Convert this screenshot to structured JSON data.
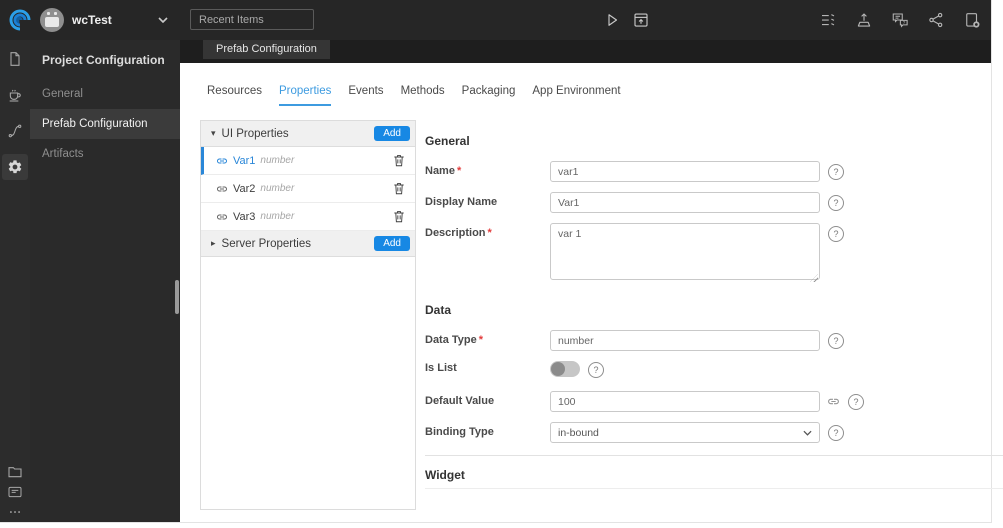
{
  "topbar": {
    "project": "wcTest",
    "recent_placeholder": "Recent Items"
  },
  "sidebar": {
    "title": "Project Configuration",
    "items": [
      {
        "label": "General"
      },
      {
        "label": "Prefab Configuration"
      },
      {
        "label": "Artifacts"
      }
    ]
  },
  "doc_tab": {
    "label": "Prefab Configuration"
  },
  "tabs": [
    {
      "label": "Resources"
    },
    {
      "label": "Properties"
    },
    {
      "label": "Events"
    },
    {
      "label": "Methods"
    },
    {
      "label": "Packaging"
    },
    {
      "label": "App Environment"
    }
  ],
  "properties_panel": {
    "ui_group": {
      "label": "UI Properties",
      "add_label": "Add",
      "items": [
        {
          "name": "Var1",
          "type": "number"
        },
        {
          "name": "Var2",
          "type": "number"
        },
        {
          "name": "Var3",
          "type": "number"
        }
      ]
    },
    "server_group": {
      "label": "Server Properties",
      "add_label": "Add"
    }
  },
  "form": {
    "general": {
      "title": "General",
      "name": {
        "label": "Name",
        "value": "var1"
      },
      "display_name": {
        "label": "Display Name",
        "value": "Var1"
      },
      "description": {
        "label": "Description",
        "value": "var 1"
      }
    },
    "data": {
      "title": "Data",
      "data_type": {
        "label": "Data Type",
        "value": "number"
      },
      "is_list": {
        "label": "Is List",
        "state": "off"
      },
      "default_value": {
        "label": "Default Value",
        "value": "100"
      },
      "binding_type": {
        "label": "Binding Type",
        "value": "in-bound"
      }
    },
    "widget": {
      "title": "Widget"
    }
  },
  "ui": {
    "help_glyph": "?",
    "caret_down": "▾",
    "caret_right": "▸"
  },
  "colors": {
    "accent_blue": "#1788e4",
    "tab_active_blue": "#3d9be0",
    "selected_item_blue": "#2a87d8",
    "topbar_bg": "#262626",
    "rail_bg": "#2c2c2c",
    "sidepanel_bg": "#2a2a2a",
    "required_red": "#e23b3b"
  }
}
